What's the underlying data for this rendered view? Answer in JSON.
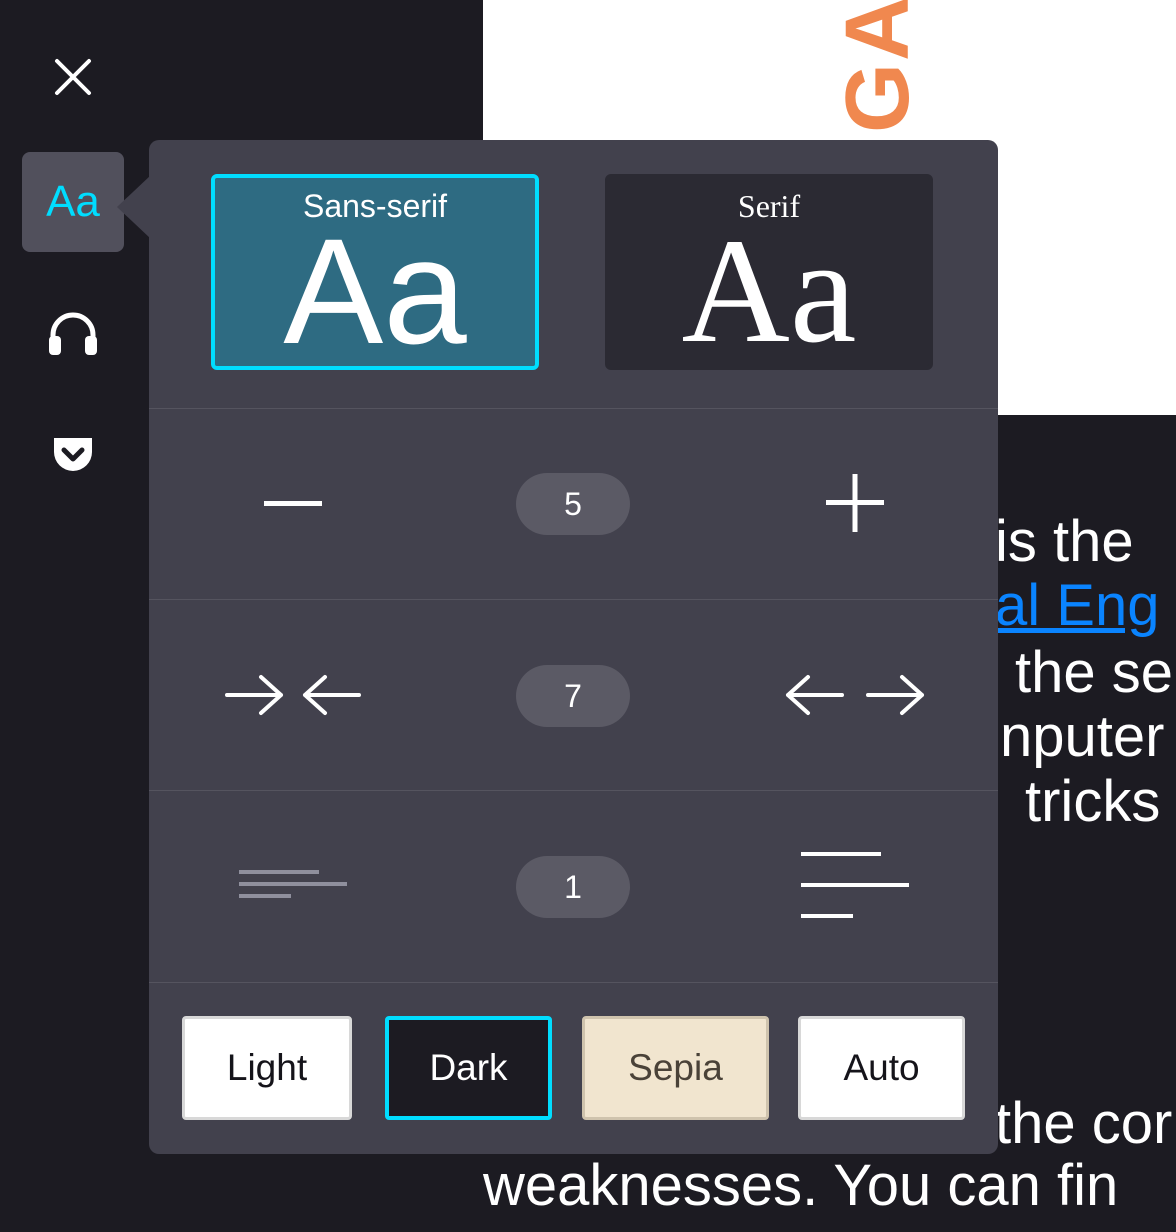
{
  "sidebar": {
    "aa_label": "Aa",
    "items": [
      {
        "icon": "close-icon"
      },
      {
        "icon": "text-settings-icon",
        "label": "Aa"
      },
      {
        "icon": "headphones-icon"
      },
      {
        "icon": "pocket-icon"
      }
    ]
  },
  "article": {
    "logo_fragment": "GA",
    "lines": [
      {
        "text": "is the"
      },
      {
        "link_text": "al Eng"
      },
      {
        "text": "the se"
      },
      {
        "text": "nputer"
      },
      {
        "text": "tricks"
      },
      {
        "text": "the cor"
      },
      {
        "text": "weaknesses. You can fin"
      }
    ]
  },
  "panel": {
    "fonts": [
      {
        "name": "Sans-serif",
        "sample": "Aa",
        "selected": true
      },
      {
        "name": "Serif",
        "sample": "Aa",
        "selected": false
      }
    ],
    "font_size": {
      "value": "5",
      "decrease_icon": "minus-icon",
      "increase_icon": "plus-icon"
    },
    "content_width": {
      "value": "7",
      "decrease_icon": "arrows-inward-icon",
      "increase_icon": "arrows-outward-icon"
    },
    "line_height": {
      "value": "1",
      "decrease_icon": "compact-lines-icon",
      "increase_icon": "spaced-lines-icon"
    },
    "themes": [
      {
        "label": "Light"
      },
      {
        "label": "Dark",
        "selected": true
      },
      {
        "label": "Sepia"
      },
      {
        "label": "Auto"
      }
    ]
  },
  "colors": {
    "accent": "#00ddff",
    "panel_bg": "#42414d",
    "app_bg": "#1c1b22",
    "link": "#0a84ff",
    "logo": "#f0884f",
    "sans_card": "#2e6b82"
  }
}
